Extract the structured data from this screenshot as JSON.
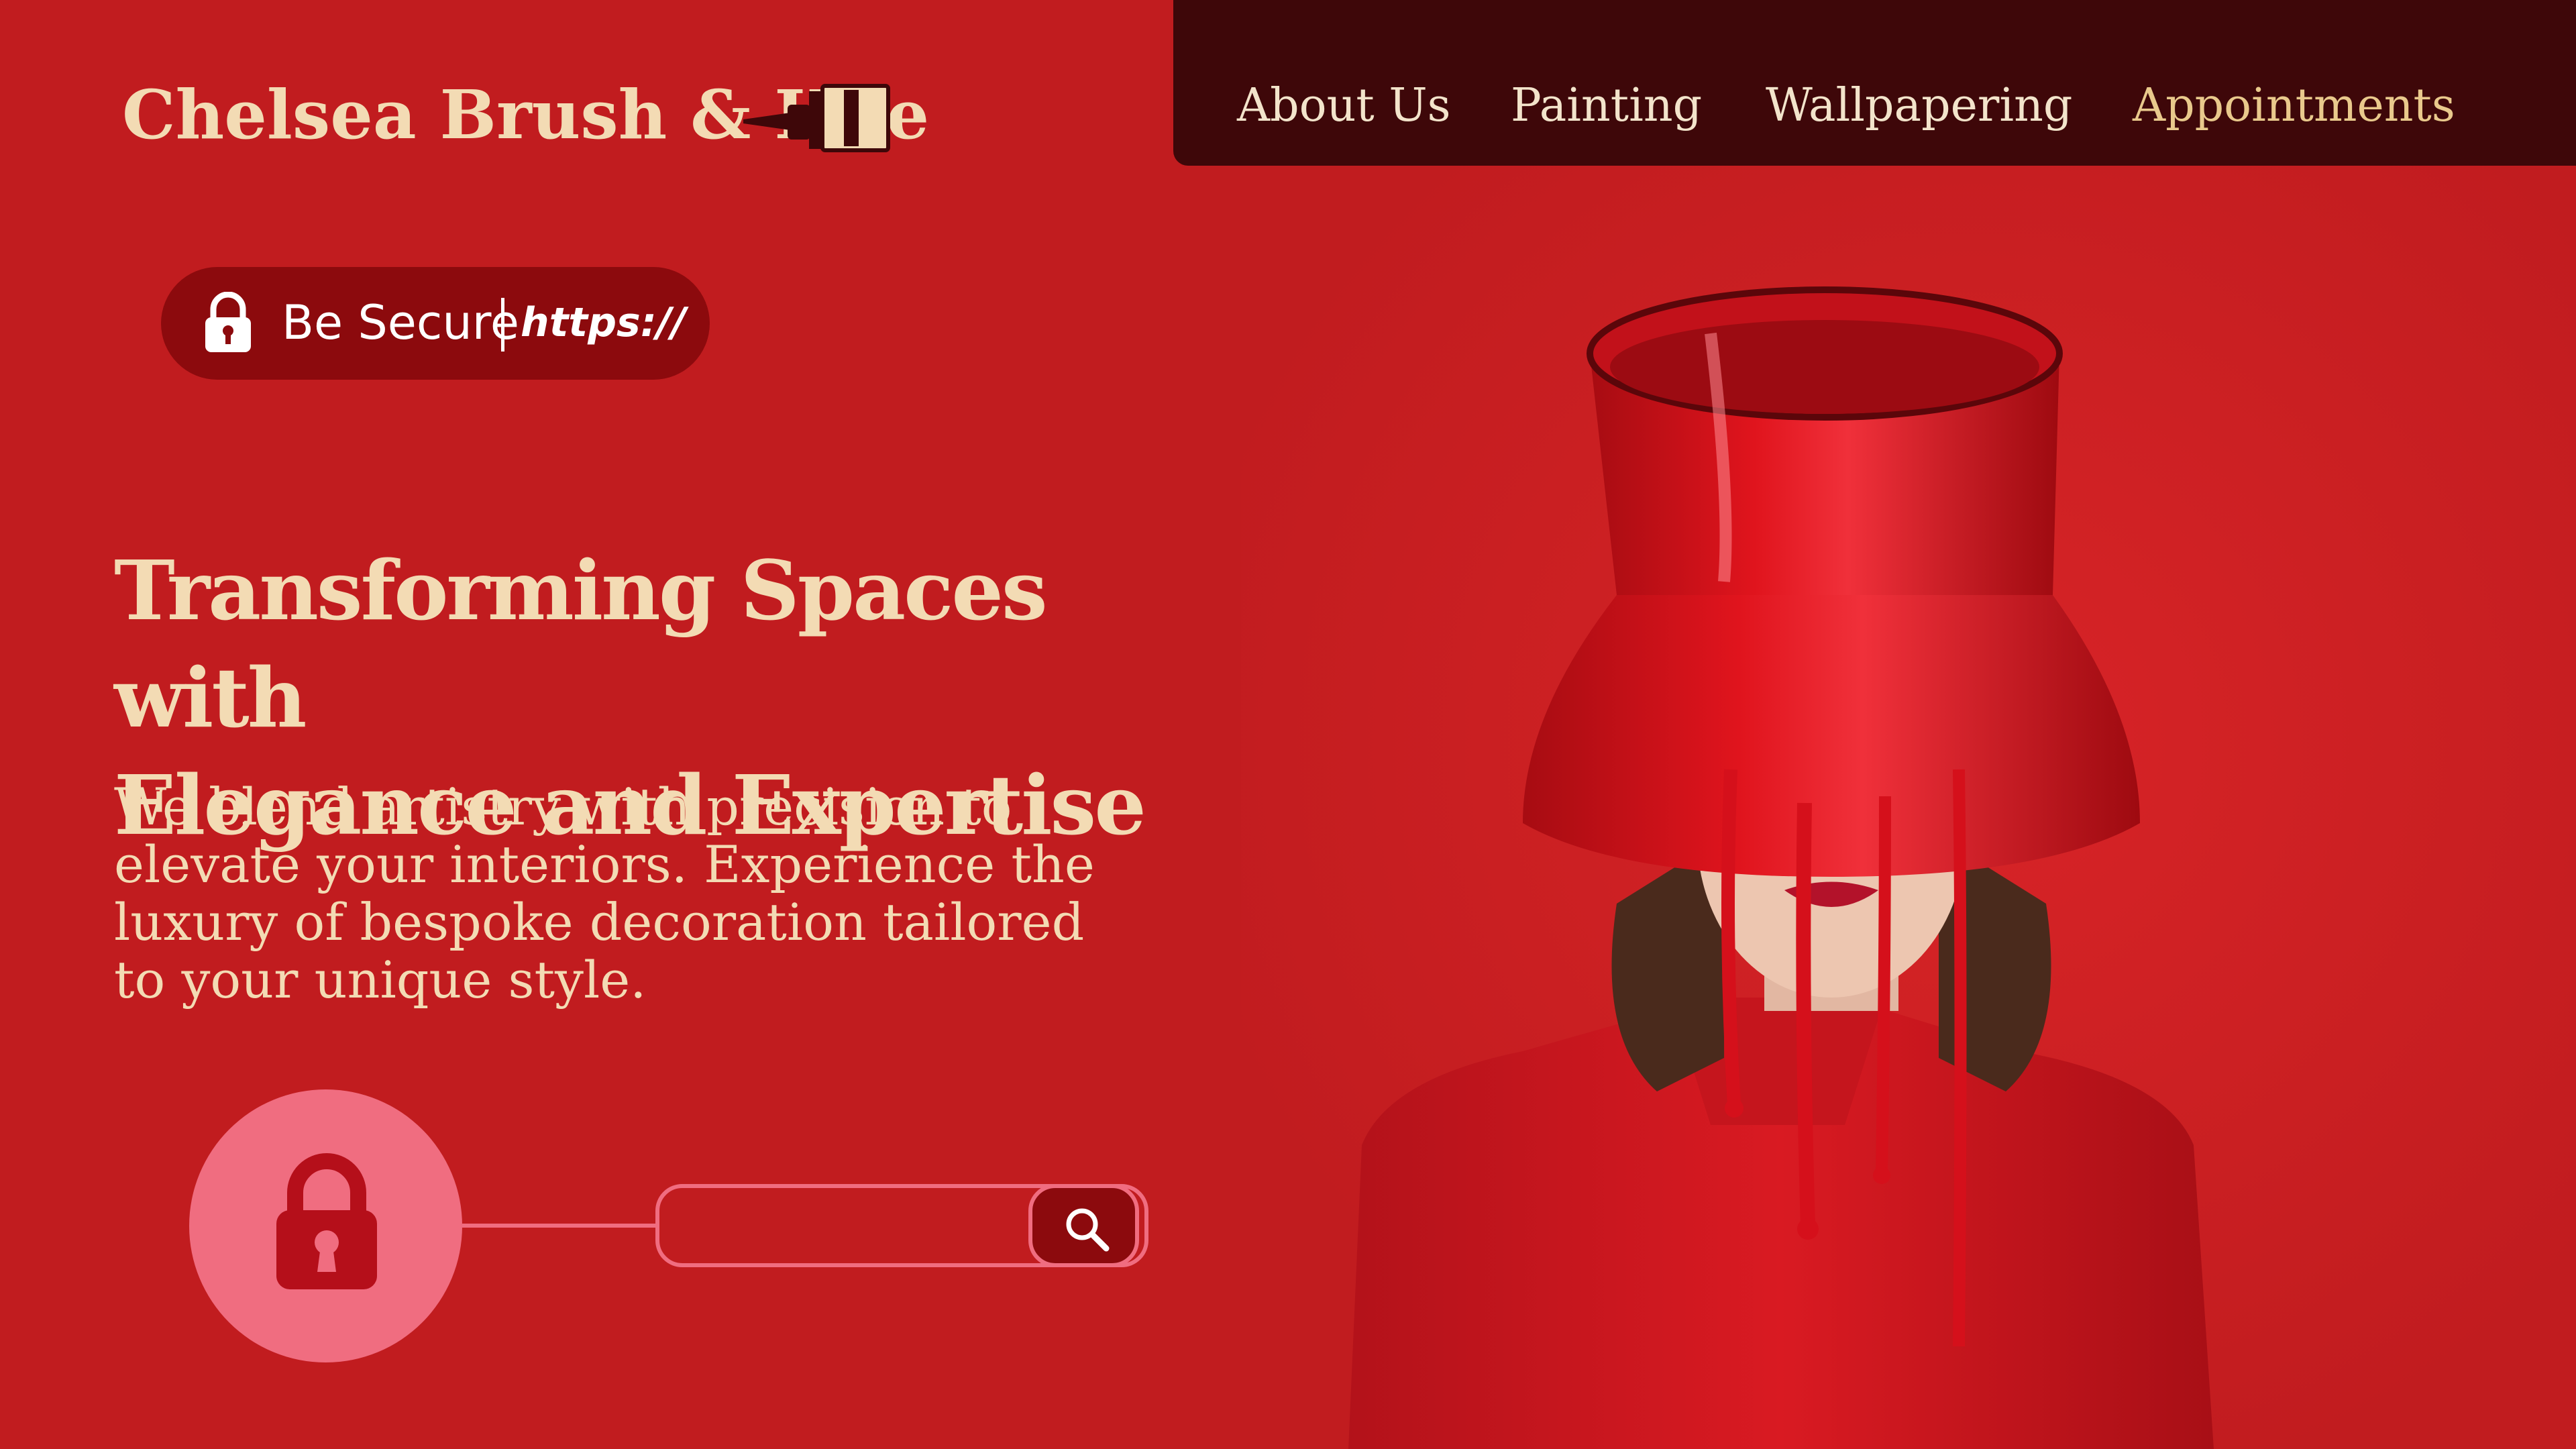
{
  "brand": {
    "name": "Chelsea Brush & Hue",
    "icon": "paintbrush-icon"
  },
  "nav": {
    "items": [
      {
        "label": "About Us",
        "active": false
      },
      {
        "label": "Painting",
        "active": false
      },
      {
        "label": "Wallpapering",
        "active": false
      },
      {
        "label": "Appointments",
        "active": true
      }
    ]
  },
  "secure_badge": {
    "icon": "lock-icon",
    "label": "Be Secure",
    "protocol": "https://"
  },
  "hero": {
    "title_line1": "Transforming Spaces with",
    "title_line2": "Elegance and Expertise",
    "body": "We blend artistry with precision to elevate your interiors. Experience the luxury of bespoke decoration tailored to your unique style."
  },
  "search": {
    "value": "",
    "placeholder": "",
    "lock_icon": "padlock-icon",
    "button_icon": "magnifier-icon"
  },
  "colors": {
    "background": "#c11c1f",
    "nav_background": "#3e0709",
    "cream": "#f3dbb4",
    "pink_accent": "#f06d80",
    "dark_red": "#8c0a0d"
  }
}
